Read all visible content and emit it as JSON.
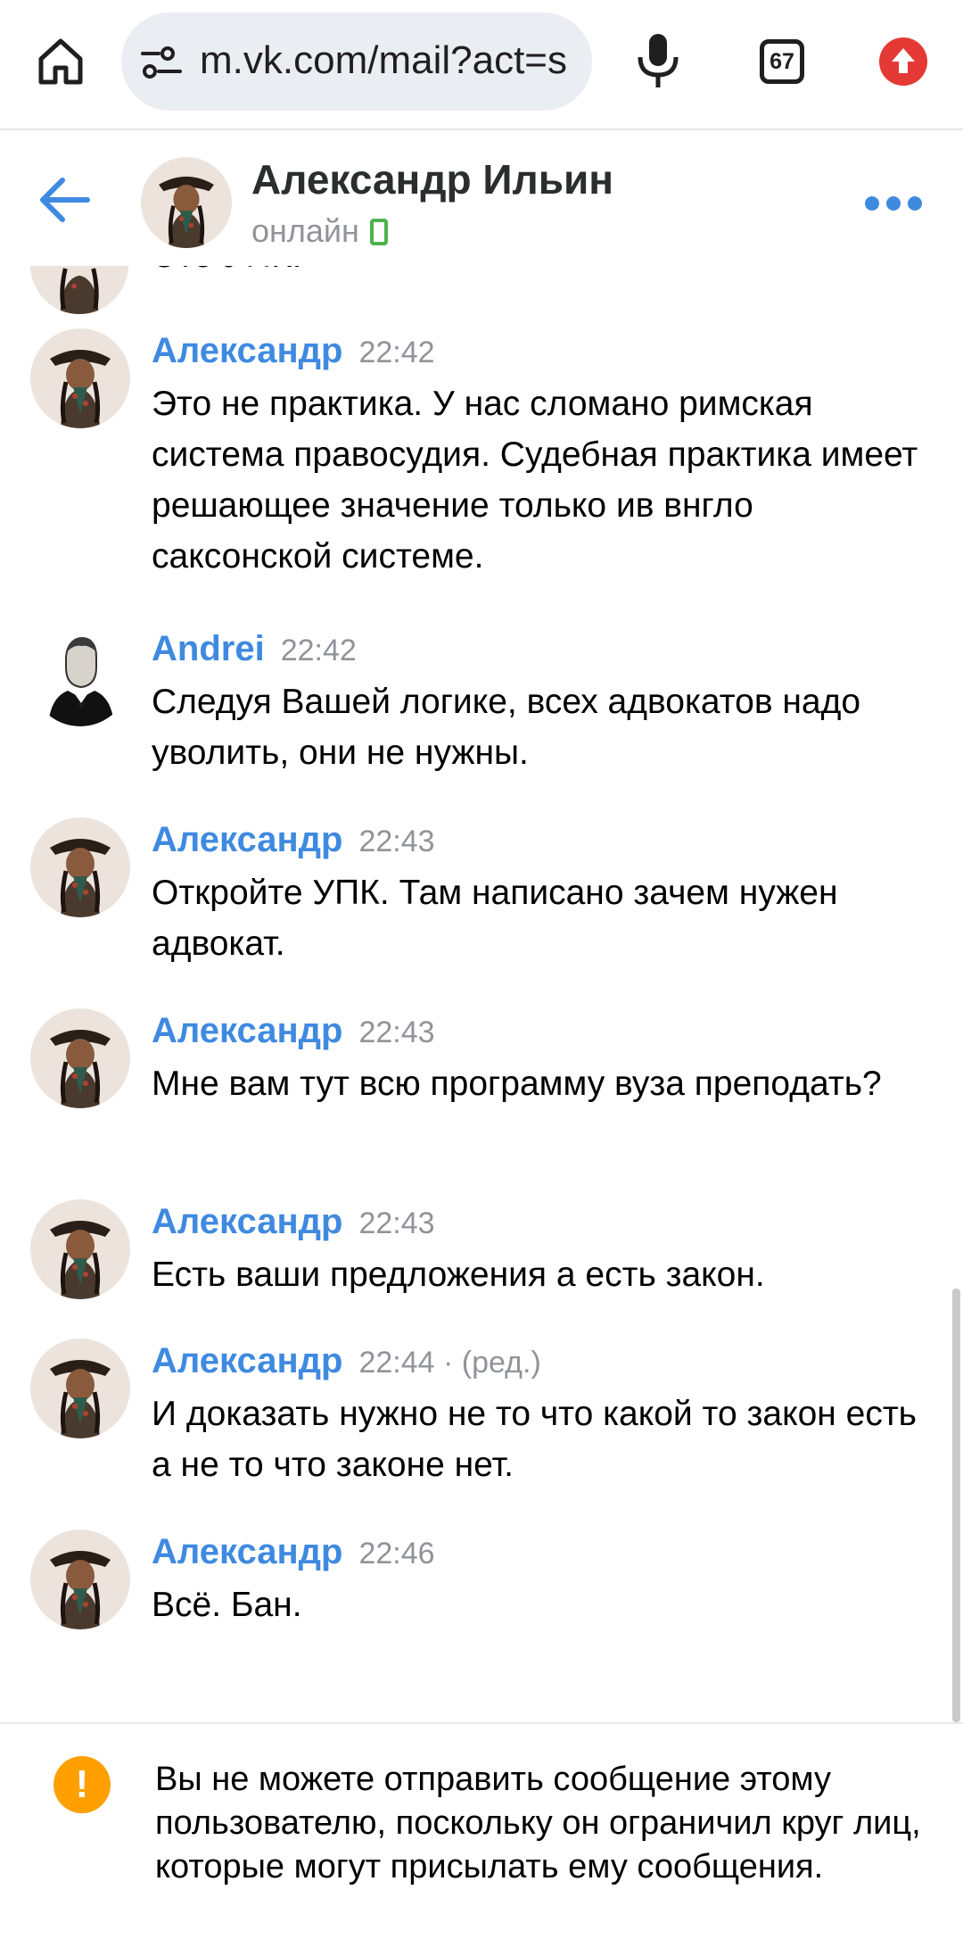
{
  "browser": {
    "url": "m.vk.com/mail?act=s",
    "tab_count": "67"
  },
  "header": {
    "name": "Александр Ильин",
    "status": "онлайн"
  },
  "partial_message": {
    "text": "Это УПК."
  },
  "messages": [
    {
      "author": "Александр",
      "time": "22:42",
      "text": "Это не практика. У нас сломано римская система правосудия. Судебная практика имеет решающее значение только ив внгло саксонской системе."
    },
    {
      "author": "Andrei",
      "time": "22:42",
      "text": "Следуя Вашей логике, всех адвокатов надо уволить, они не нужны."
    },
    {
      "author": "Александр",
      "time": "22:43",
      "text": "Откройте УПК. Там написано зачем нужен адвокат."
    },
    {
      "author": "Александр",
      "time": "22:43",
      "text": "Мне вам тут всю программу вуза преподать?"
    },
    {
      "author": "Александр",
      "time": "22:43",
      "text": "Есть ваши предложения а есть закон."
    },
    {
      "author": "Александр",
      "time": "22:44 · (ред.)",
      "text": "И доказать нужно не то что какой то закон есть а не то что законе нет."
    },
    {
      "author": "Александр",
      "time": "22:46",
      "text": "Всё. Бан."
    }
  ],
  "notice": {
    "icon": "!",
    "text": "Вы не можете отправить сообщение этому пользователю, поскольку он ограничил круг лиц, которые могут присылать ему сообщения."
  },
  "colors": {
    "accent": "#3f8ae0",
    "online": "#4bb34b",
    "warning": "#ffa000",
    "browser_update": "#e53935"
  }
}
